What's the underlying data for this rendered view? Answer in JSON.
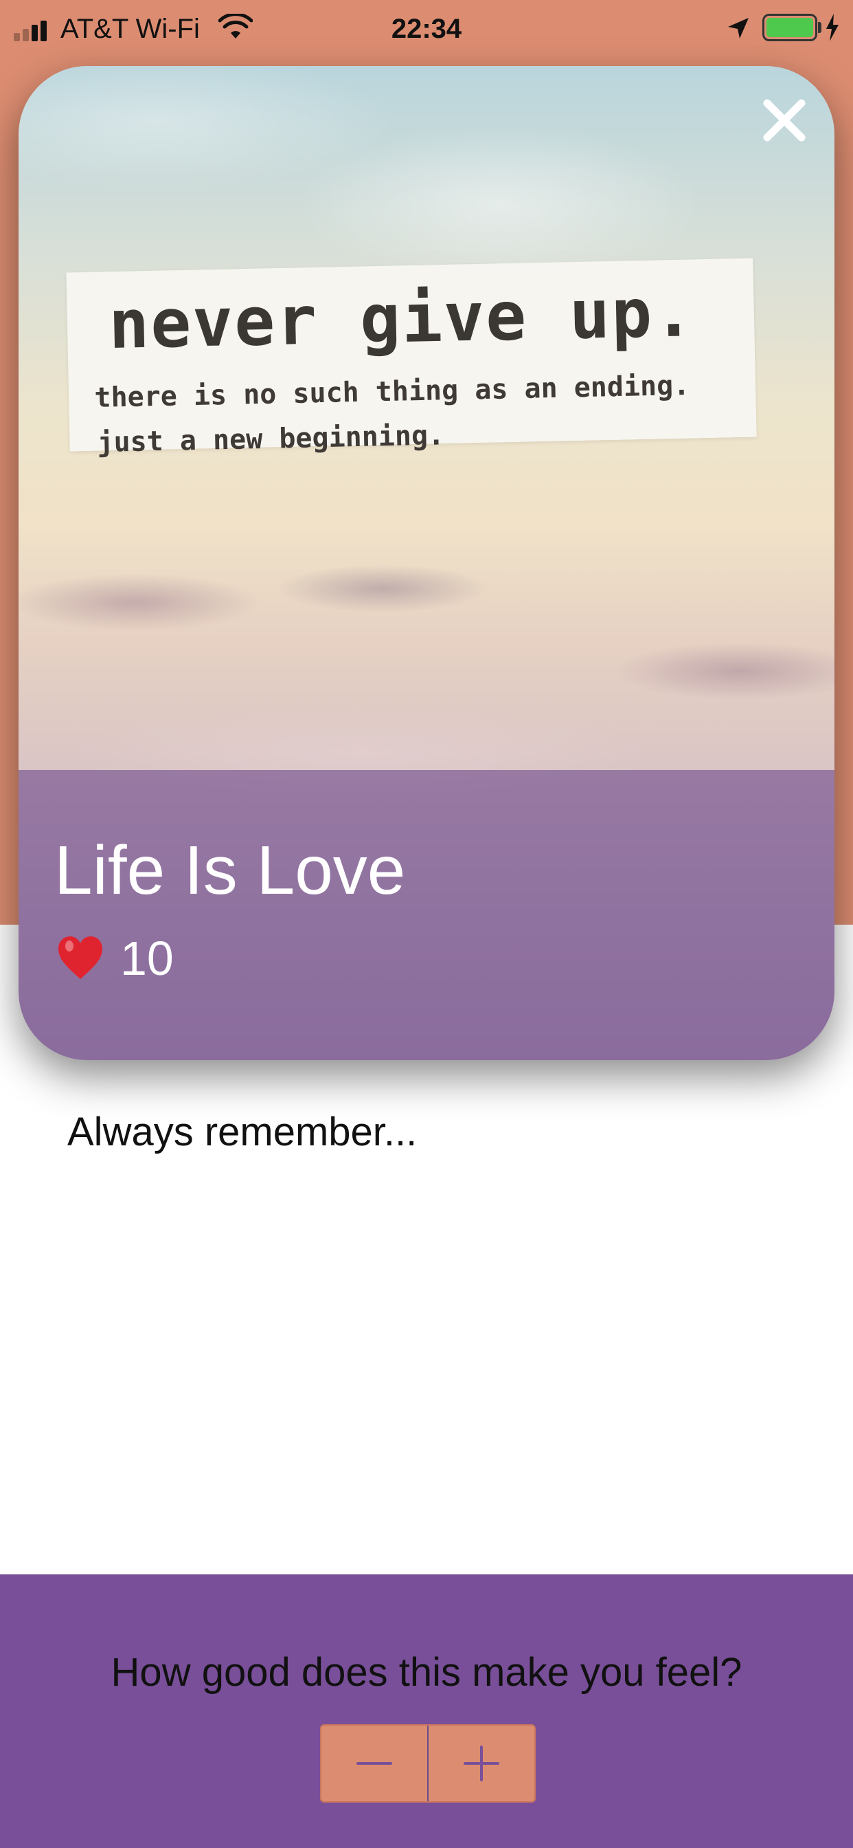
{
  "status_bar": {
    "carrier": "AT&T Wi-Fi",
    "time": "22:34"
  },
  "card": {
    "image_text": {
      "headline": "never give up.",
      "line1": "there is no such thing as an ending.",
      "line2": "just a new beginning."
    },
    "title": "Life Is Love",
    "likes": "10"
  },
  "description": "Always remember...",
  "rating": {
    "question": "How good does this make you feel?"
  },
  "colors": {
    "header_bg": "#dc8d71",
    "panel_bg": "#794f99",
    "stepper_bg": "#dc8d71"
  }
}
